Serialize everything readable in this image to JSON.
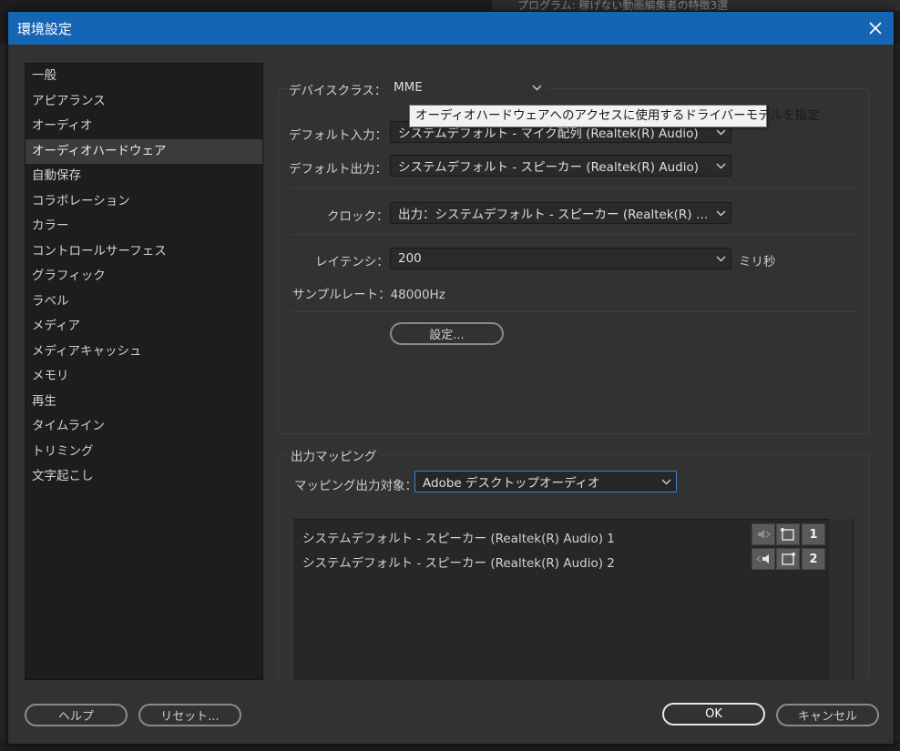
{
  "background": {
    "top_strip_text": "プログラム: 稼げない動画編集者の特徴3選"
  },
  "dialog": {
    "title": "環境設定"
  },
  "sidebar": {
    "items": [
      {
        "label": "一般"
      },
      {
        "label": "アピアランス"
      },
      {
        "label": "オーディオ"
      },
      {
        "label": "オーディオハードウェア",
        "selected": true
      },
      {
        "label": "自動保存"
      },
      {
        "label": "コラボレーション"
      },
      {
        "label": "カラー"
      },
      {
        "label": "コントロールサーフェス"
      },
      {
        "label": "グラフィック"
      },
      {
        "label": "ラベル"
      },
      {
        "label": "メディア"
      },
      {
        "label": "メディアキャッシュ"
      },
      {
        "label": "メモリ"
      },
      {
        "label": "再生"
      },
      {
        "label": "タイムライン"
      },
      {
        "label": "トリミング"
      },
      {
        "label": "文字起こし"
      }
    ]
  },
  "hardware": {
    "device_class_label": "デバイスクラス：",
    "device_class_value": "MME",
    "tooltip": "オーディオハードウェアへのアクセスに使用するドライバーモデルを指定",
    "default_input_label": "デフォルト入力：",
    "default_input_value": "システムデフォルト - マイク配列 (Realtek(R) Audio)",
    "default_output_label": "デフォルト出力：",
    "default_output_value": "システムデフォルト - スピーカー (Realtek(R) Audio)",
    "clock_label": "クロック：",
    "clock_value": "出力：システムデフォルト - スピーカー (Realtek(R) A...",
    "latency_label": "レイテンシ：",
    "latency_value": "200",
    "latency_unit": "ミリ秒",
    "sample_rate_text": "サンプルレート：48000Hz",
    "settings_button": "設定..."
  },
  "output_mapping": {
    "section_title": "出力マッピング",
    "target_label": "マッピング出力対象：",
    "target_value": "Adobe デスクトップオーディオ",
    "channels": [
      {
        "label": "システムデフォルト - スピーカー (Realtek(R) Audio) 1",
        "number": "1"
      },
      {
        "label": "システムデフォルト - スピーカー (Realtek(R) Audio) 2",
        "number": "2"
      }
    ]
  },
  "footer": {
    "help": "ヘルプ",
    "reset": "リセット...",
    "ok": "OK",
    "cancel": "キャンセル"
  },
  "colors": {
    "titlebar": "#1565b5",
    "focus": "#3a83d6",
    "panel": "#323232"
  }
}
